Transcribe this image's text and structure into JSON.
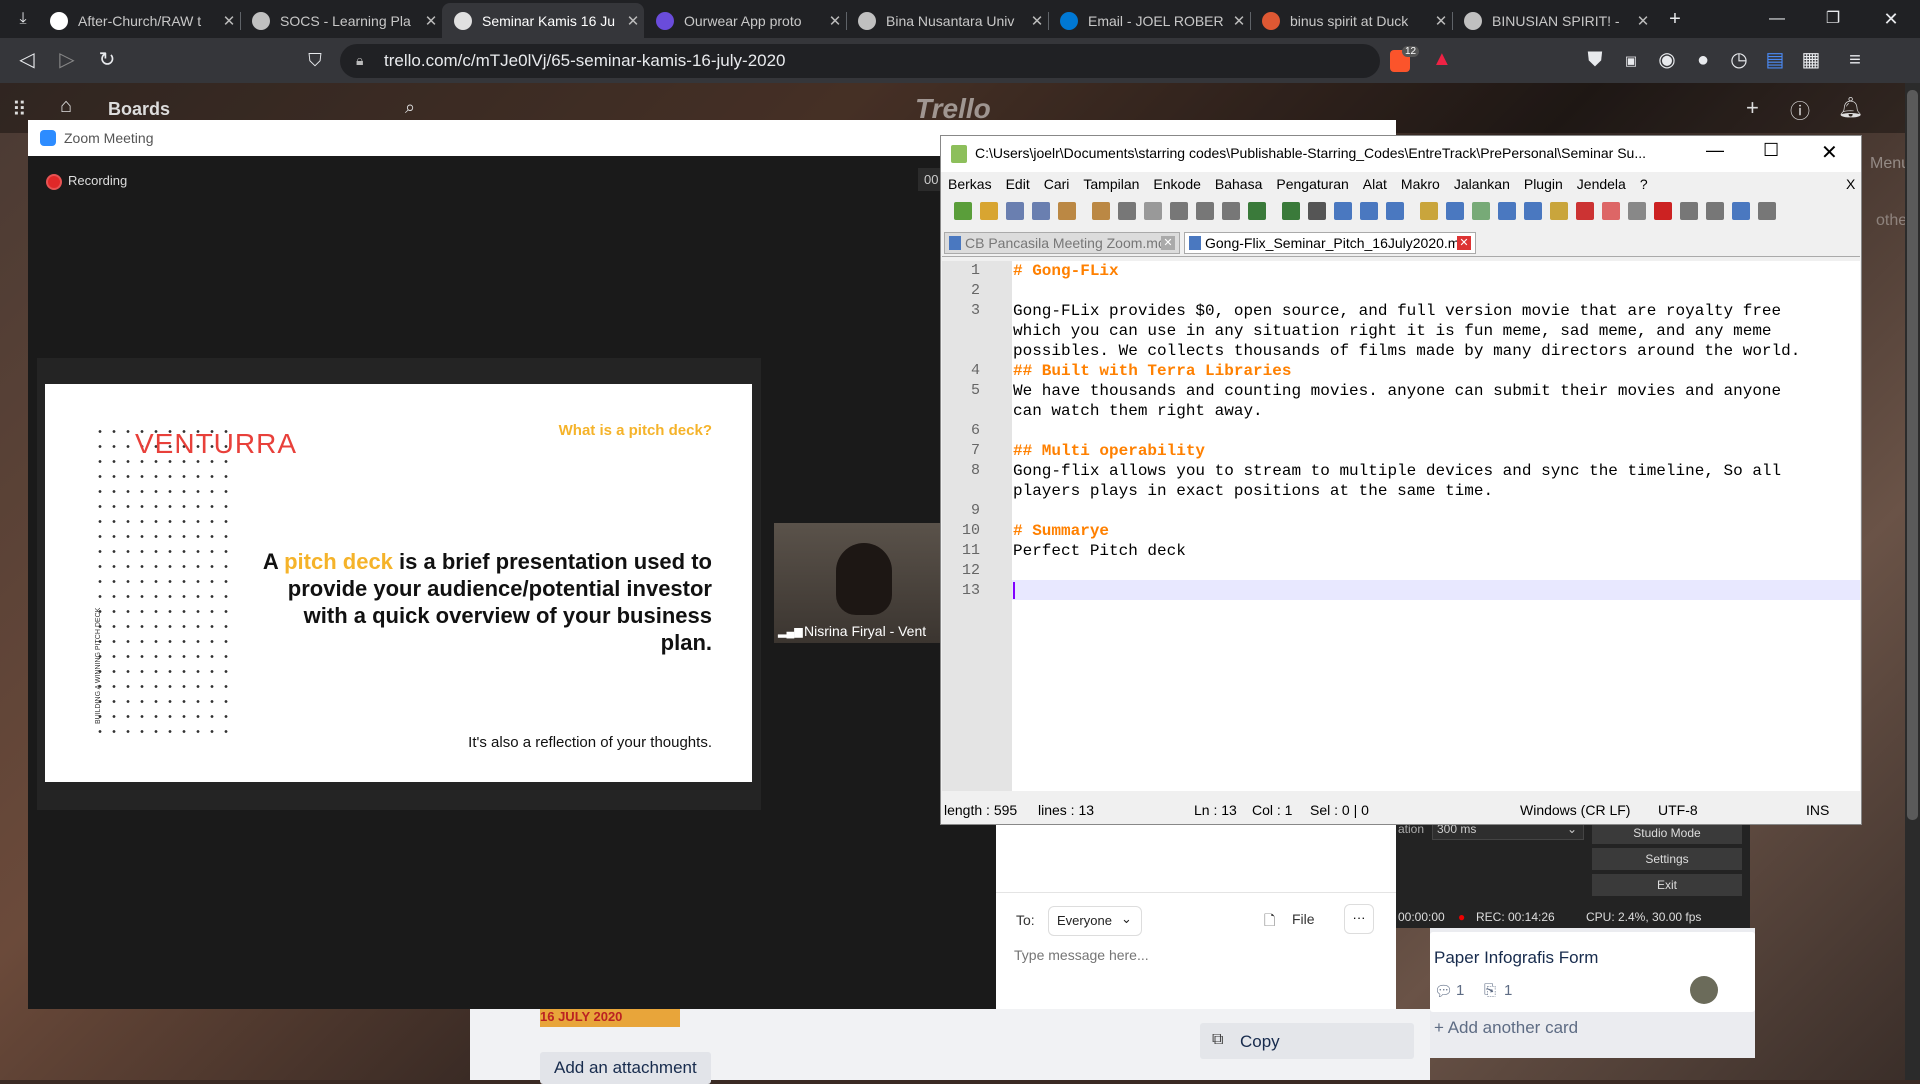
{
  "browser": {
    "tabs": [
      {
        "title": "After-Church/RAW t",
        "icon_color": "#ffffff"
      },
      {
        "title": "SOCS - Learning Pla",
        "icon_color": "#c0c0c0"
      },
      {
        "title": "Seminar Kamis 16 Ju",
        "icon_color": "#e0e0e0",
        "active": true
      },
      {
        "title": "Ourwear App proto",
        "icon_color": "#6a4cdb"
      },
      {
        "title": "Bina Nusantara Univ",
        "icon_color": "#c0c0c0"
      },
      {
        "title": "Email - JOEL ROBER",
        "icon_color": "#0078d4"
      },
      {
        "title": "binus spirit at Duck",
        "icon_color": "#de5833"
      },
      {
        "title": "BINUSIAN SPIRIT! -",
        "icon_color": "#c0c0c0"
      }
    ],
    "new_tab": "+",
    "url": "trello.com/c/mTJe0lVj/65-seminar-kamis-16-july-2020",
    "brave_badge": "12"
  },
  "trello": {
    "boards_label": "Boards",
    "logo": "Trello",
    "menu_hint": "Menu",
    "other_hint": "other",
    "add_attachment": "Add an attachment",
    "copy": "Copy",
    "card_title": "Paper Infografis Form",
    "card_comments": "1",
    "card_attachments": "1",
    "add_card": "+ Add another card",
    "thumb_date": "16 JULY 2020"
  },
  "zoom": {
    "title": "Zoom Meeting",
    "recording": "Recording",
    "timer_partial": "00",
    "participant_name": "Nisrina Firyal - Vent",
    "chat": {
      "to_label": "To:",
      "recipient": "Everyone",
      "file": "File",
      "more": "···",
      "placeholder": "Type message here..."
    },
    "slide": {
      "logo": "VENTURRA",
      "question": "What is a pitch deck?",
      "vertical_text": "BUILDING A WINNING PITCH DECK",
      "body_prefix": "A ",
      "body_highlight": "pitch deck",
      "body_rest": " is a brief presentation used to provide your audience/potential investor with a quick overview of your business plan.",
      "footer": "It's also a reflection of your thoughts."
    }
  },
  "notepadpp": {
    "title": "C:\\Users\\joelr\\Documents\\starring codes\\Publishable-Starring_Codes\\EntreTrack\\PrePersonal\\Seminar Su...",
    "menu": [
      "Berkas",
      "Edit",
      "Cari",
      "Tampilan",
      "Enkode",
      "Bahasa",
      "Pengaturan",
      "Alat",
      "Makro",
      "Jalankan",
      "Plugin",
      "Jendela",
      "?"
    ],
    "close_x": "X",
    "tabs": [
      {
        "label": "CB Pancasila Meeting Zoom.md",
        "active": false
      },
      {
        "label": "Gong-Flix_Seminar_Pitch_16July2020.md",
        "active": true
      }
    ],
    "lines": [
      {
        "n": "1",
        "text": "# Gong-FLix",
        "header": true
      },
      {
        "n": "2",
        "text": ""
      },
      {
        "n": "3",
        "text": "Gong-FLix provides $0, open source, and full version movie that are royalty free"
      },
      {
        "n": "",
        "text": "which you can use in any situation right it is fun meme, sad meme, and any meme"
      },
      {
        "n": "",
        "text": "possibles. We collects thousands of films made by many directors around the world."
      },
      {
        "n": "4",
        "text": "## Built with Terra Libraries",
        "header": true
      },
      {
        "n": "5",
        "text": "We have thousands and counting movies. anyone can submit their movies and anyone"
      },
      {
        "n": "",
        "text": "can watch them right away."
      },
      {
        "n": "6",
        "text": ""
      },
      {
        "n": "7",
        "text": "## Multi operability",
        "header": true
      },
      {
        "n": "8",
        "text": "Gong-flix allows you to stream to multiple devices and sync the timeline, So all"
      },
      {
        "n": "",
        "text": "players plays in exact positions at the same time."
      },
      {
        "n": "9",
        "text": ""
      },
      {
        "n": "10",
        "text": "# Summarye",
        "header": true
      },
      {
        "n": "11",
        "text": "Perfect Pitch deck"
      },
      {
        "n": "12",
        "text": ""
      },
      {
        "n": "13",
        "text": ""
      }
    ],
    "status": {
      "length": "length : 595",
      "lines": "lines : 13",
      "ln": "Ln : 13",
      "col": "Col : 1",
      "sel": "Sel : 0 | 0",
      "eol": "Windows (CR LF)",
      "encoding": "UTF-8",
      "mode": "INS"
    }
  },
  "obs": {
    "duration_label": "ation",
    "duration_value": "300 ms",
    "studio_mode": "Studio Mode",
    "settings": "Settings",
    "exit": "Exit",
    "live": "00:00:00",
    "rec": "REC: 00:14:26",
    "cpu": "CPU: 2.4%, 30.00 fps"
  }
}
